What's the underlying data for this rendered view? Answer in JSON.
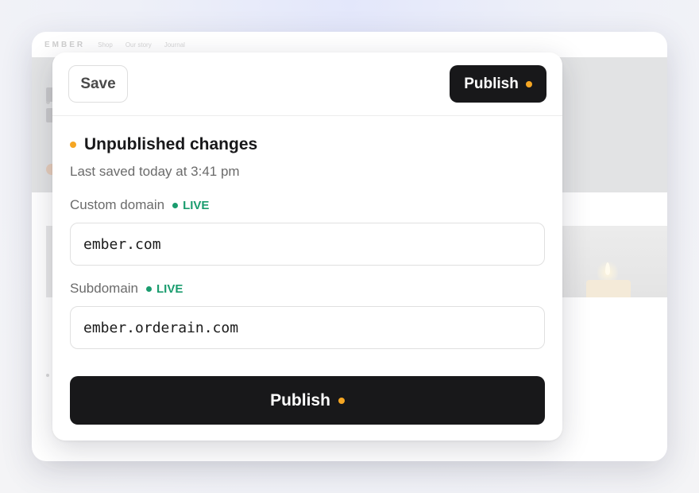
{
  "background_site": {
    "logo": "EMBER",
    "nav_items": [
      "Shop",
      "Our story",
      "Journal"
    ]
  },
  "header": {
    "save_label": "Save",
    "publish_label": "Publish"
  },
  "status": {
    "title": "Unpublished changes",
    "last_saved": "Last saved today at 3:41 pm"
  },
  "fields": {
    "custom_domain": {
      "label": "Custom domain",
      "badge": "LIVE",
      "value": "ember.com"
    },
    "subdomain": {
      "label": "Subdomain",
      "badge": "LIVE",
      "value": "ember.orderain.com"
    }
  },
  "footer": {
    "publish_label": "Publish"
  },
  "colors": {
    "accent_dark": "#18181a",
    "pending_dot": "#f5a623",
    "live_green": "#1a9c6e"
  }
}
